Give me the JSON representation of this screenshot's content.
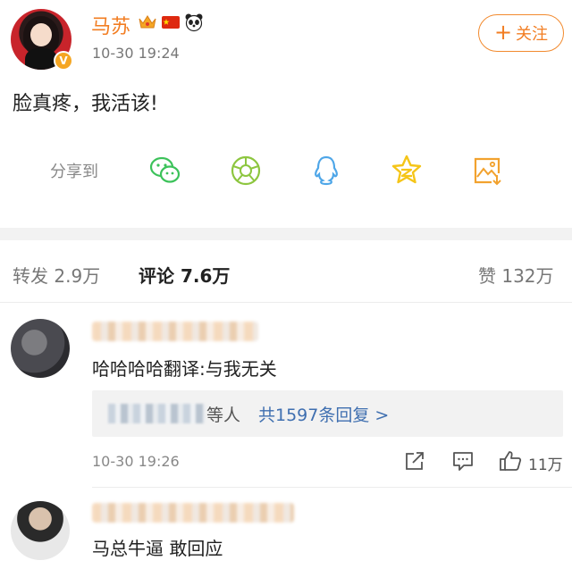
{
  "post": {
    "author": "马苏",
    "timestamp": "10-30 19:24",
    "follow_label": "关注",
    "text": "脸真疼，我活该!",
    "verified_mark": "V"
  },
  "share": {
    "label": "分享到",
    "targets": [
      "wechat-icon",
      "moments-icon",
      "qq-icon",
      "qzone-icon",
      "save-image-icon"
    ]
  },
  "tabs": {
    "repost_label": "转发",
    "repost_count": "2.9万",
    "comment_label": "评论",
    "comment_count": "7.6万",
    "like_label": "赞",
    "like_count": "132万"
  },
  "comments": [
    {
      "text": "哈哈哈哈翻译:与我无关",
      "reply_suffix": "等人",
      "reply_link": "共1597条回复 >",
      "timestamp": "10-30 19:26",
      "like_count": "11万"
    },
    {
      "text": "马总牛逼 敢回应"
    }
  ],
  "colors": {
    "accent_orange": "#f27d22",
    "link_blue": "#3f6fb0",
    "wechat_green": "#3cc25a",
    "moments_green": "#8dc63f",
    "qq_blue": "#4ea6e8",
    "qzone_yellow": "#f5c518"
  }
}
